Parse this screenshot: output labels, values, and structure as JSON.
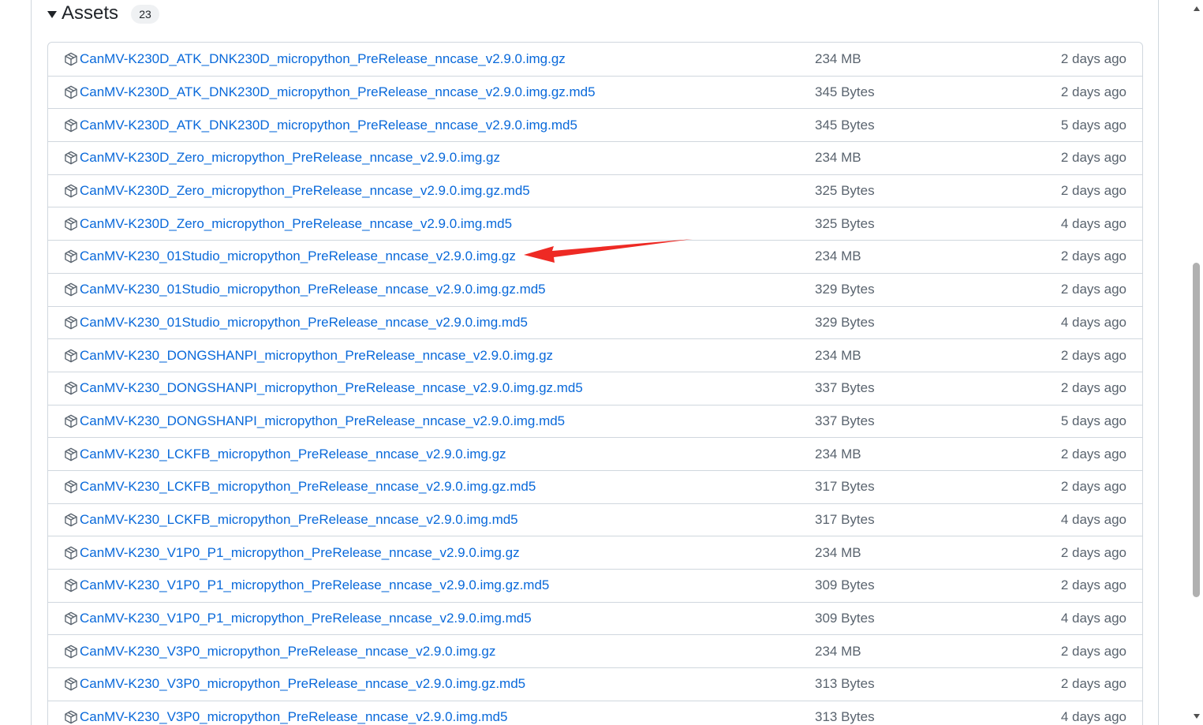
{
  "assets": {
    "title": "Assets",
    "count": "23",
    "rows": [
      {
        "name": "CanMV-K230D_ATK_DNK230D_micropython_PreRelease_nncase_v2.9.0.img.gz",
        "size": "234 MB",
        "date": "2 days ago"
      },
      {
        "name": "CanMV-K230D_ATK_DNK230D_micropython_PreRelease_nncase_v2.9.0.img.gz.md5",
        "size": "345 Bytes",
        "date": "2 days ago"
      },
      {
        "name": "CanMV-K230D_ATK_DNK230D_micropython_PreRelease_nncase_v2.9.0.img.md5",
        "size": "345 Bytes",
        "date": "5 days ago"
      },
      {
        "name": "CanMV-K230D_Zero_micropython_PreRelease_nncase_v2.9.0.img.gz",
        "size": "234 MB",
        "date": "2 days ago"
      },
      {
        "name": "CanMV-K230D_Zero_micropython_PreRelease_nncase_v2.9.0.img.gz.md5",
        "size": "325 Bytes",
        "date": "2 days ago"
      },
      {
        "name": "CanMV-K230D_Zero_micropython_PreRelease_nncase_v2.9.0.img.md5",
        "size": "325 Bytes",
        "date": "4 days ago"
      },
      {
        "name": "CanMV-K230_01Studio_micropython_PreRelease_nncase_v2.9.0.img.gz",
        "size": "234 MB",
        "date": "2 days ago"
      },
      {
        "name": "CanMV-K230_01Studio_micropython_PreRelease_nncase_v2.9.0.img.gz.md5",
        "size": "329 Bytes",
        "date": "2 days ago"
      },
      {
        "name": "CanMV-K230_01Studio_micropython_PreRelease_nncase_v2.9.0.img.md5",
        "size": "329 Bytes",
        "date": "4 days ago"
      },
      {
        "name": "CanMV-K230_DONGSHANPI_micropython_PreRelease_nncase_v2.9.0.img.gz",
        "size": "234 MB",
        "date": "2 days ago"
      },
      {
        "name": "CanMV-K230_DONGSHANPI_micropython_PreRelease_nncase_v2.9.0.img.gz.md5",
        "size": "337 Bytes",
        "date": "2 days ago"
      },
      {
        "name": "CanMV-K230_DONGSHANPI_micropython_PreRelease_nncase_v2.9.0.img.md5",
        "size": "337 Bytes",
        "date": "5 days ago"
      },
      {
        "name": "CanMV-K230_LCKFB_micropython_PreRelease_nncase_v2.9.0.img.gz",
        "size": "234 MB",
        "date": "2 days ago"
      },
      {
        "name": "CanMV-K230_LCKFB_micropython_PreRelease_nncase_v2.9.0.img.gz.md5",
        "size": "317 Bytes",
        "date": "2 days ago"
      },
      {
        "name": "CanMV-K230_LCKFB_micropython_PreRelease_nncase_v2.9.0.img.md5",
        "size": "317 Bytes",
        "date": "4 days ago"
      },
      {
        "name": "CanMV-K230_V1P0_P1_micropython_PreRelease_nncase_v2.9.0.img.gz",
        "size": "234 MB",
        "date": "2 days ago"
      },
      {
        "name": "CanMV-K230_V1P0_P1_micropython_PreRelease_nncase_v2.9.0.img.gz.md5",
        "size": "309 Bytes",
        "date": "2 days ago"
      },
      {
        "name": "CanMV-K230_V1P0_P1_micropython_PreRelease_nncase_v2.9.0.img.md5",
        "size": "309 Bytes",
        "date": "4 days ago"
      },
      {
        "name": "CanMV-K230_V3P0_micropython_PreRelease_nncase_v2.9.0.img.gz",
        "size": "234 MB",
        "date": "2 days ago"
      },
      {
        "name": "CanMV-K230_V3P0_micropython_PreRelease_nncase_v2.9.0.img.gz.md5",
        "size": "313 Bytes",
        "date": "2 days ago"
      },
      {
        "name": "CanMV-K230_V3P0_micropython_PreRelease_nncase_v2.9.0.img.md5",
        "size": "313 Bytes",
        "date": "4 days ago"
      }
    ]
  },
  "row_icon": "package-icon",
  "annotation": {
    "icon": "red-arrow-annotation",
    "color": "#ee2a24",
    "points_to_row": 6
  },
  "colors": {
    "link": "#0969da",
    "muted": "#59636e",
    "border": "#d0d7de"
  }
}
